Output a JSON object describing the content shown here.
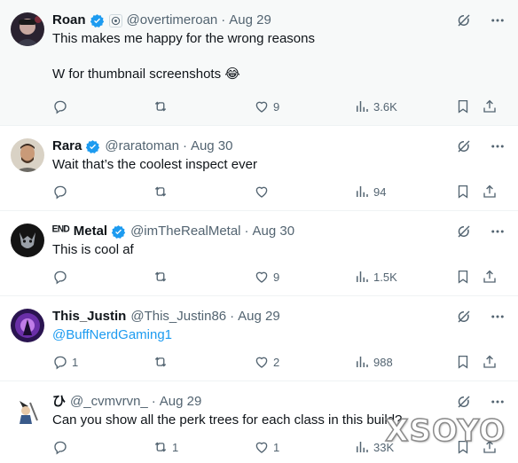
{
  "tweets": [
    {
      "name": "Roan",
      "handle": "@overtimeroan",
      "time": "Aug 29",
      "text_lines": [
        "This makes me happy for the wrong reasons",
        "",
        "W for thumbnail screenshots 😂"
      ],
      "replies": "",
      "retweets": "",
      "likes": "9",
      "views": "3.6K"
    },
    {
      "name": "Rara",
      "handle": "@raratoman",
      "time": "Aug 30",
      "text_lines": [
        "Wait that’s the coolest inspect ever"
      ],
      "replies": "",
      "retweets": "",
      "likes": "",
      "views": "94"
    },
    {
      "name": "ᴱᴺᴰ Metal",
      "handle": "@imTheRealMetal",
      "time": "Aug 30",
      "text_lines": [
        "This is cool af"
      ],
      "replies": "",
      "retweets": "",
      "likes": "9",
      "views": "1.5K"
    },
    {
      "name": "This_Justin",
      "handle": "@This_Justin86",
      "time": "Aug 29",
      "text_lines": [
        "@BuffNerdGaming1"
      ],
      "replies": "1",
      "retweets": "",
      "likes": "2",
      "views": "988"
    },
    {
      "name": "ひ",
      "handle": "@_cvmvrvn_",
      "time": "Aug 29",
      "text_lines": [
        "Can you show all the perk trees for each class in this build?"
      ],
      "replies": "",
      "retweets": "1",
      "likes": "1",
      "views": "33K"
    }
  ],
  "separator": "·",
  "watermark": "XSOYO",
  "colors": {
    "text": "#0f1419",
    "secondary": "#536471",
    "accent": "#1d9bf0",
    "highlight_bg": "#f7f9f9",
    "border": "#eff3f4"
  },
  "icons": [
    "verified-badge-icon",
    "affiliate-badge-icon",
    "grok-icon",
    "more-icon",
    "reply-icon",
    "retweet-icon",
    "like-icon",
    "views-icon",
    "bookmark-icon",
    "share-icon"
  ]
}
